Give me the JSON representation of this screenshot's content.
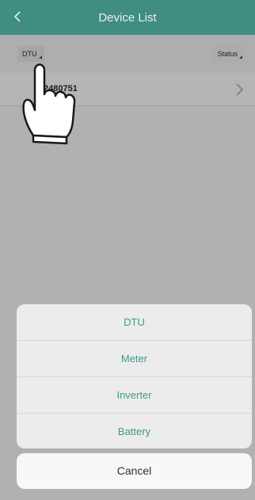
{
  "header": {
    "title": "Device List",
    "back_icon": "chevron-left-icon"
  },
  "filters": {
    "type_label": "DTU",
    "status_label": "Status"
  },
  "device_list": [
    {
      "serial": "2480751"
    }
  ],
  "action_sheet": {
    "options": [
      {
        "label": "DTU"
      },
      {
        "label": "Meter"
      },
      {
        "label": "Inverter"
      },
      {
        "label": "Battery"
      }
    ],
    "cancel_label": "Cancel"
  },
  "colors": {
    "header": "#3f8e81",
    "accent": "#3f9a88",
    "overlay": "#b1b1b1"
  }
}
